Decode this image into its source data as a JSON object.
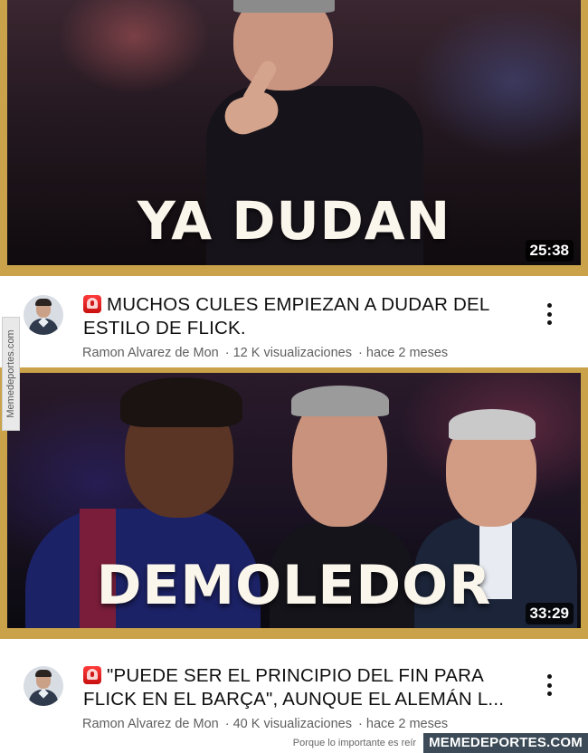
{
  "videos": [
    {
      "thumbnail_title": "YA DUDAN",
      "duration": "25:38",
      "title": "MUCHOS CULES EMPIEZAN A DUDAR DEL ESTILO DE FLICK.",
      "channel": "Ramon Alvarez de Mon",
      "views": "· 12 K visualizaciones",
      "age": "· hace 2 meses"
    },
    {
      "thumbnail_title": "DEMOLEDOR",
      "duration": "33:29",
      "title": "\"PUEDE SER EL PRINCIPIO DEL FIN PARA FLICK EN EL BARÇA\", AUNQUE EL ALEMÁN L...",
      "channel": "Ramon Alvarez de Mon",
      "views": "· 40 K visualizaciones",
      "age": "· hace 2 meses"
    }
  ],
  "watermark": {
    "side": "Memedeportes.com",
    "tagline": "Porque lo importante es reír",
    "brand": "MEMEDEPORTES.COM"
  },
  "colors": {
    "thumbnail_frame": "#c9a24a",
    "text_primary": "#0f0f0f",
    "text_secondary": "#606060",
    "alert_red": "#e01b1b"
  }
}
